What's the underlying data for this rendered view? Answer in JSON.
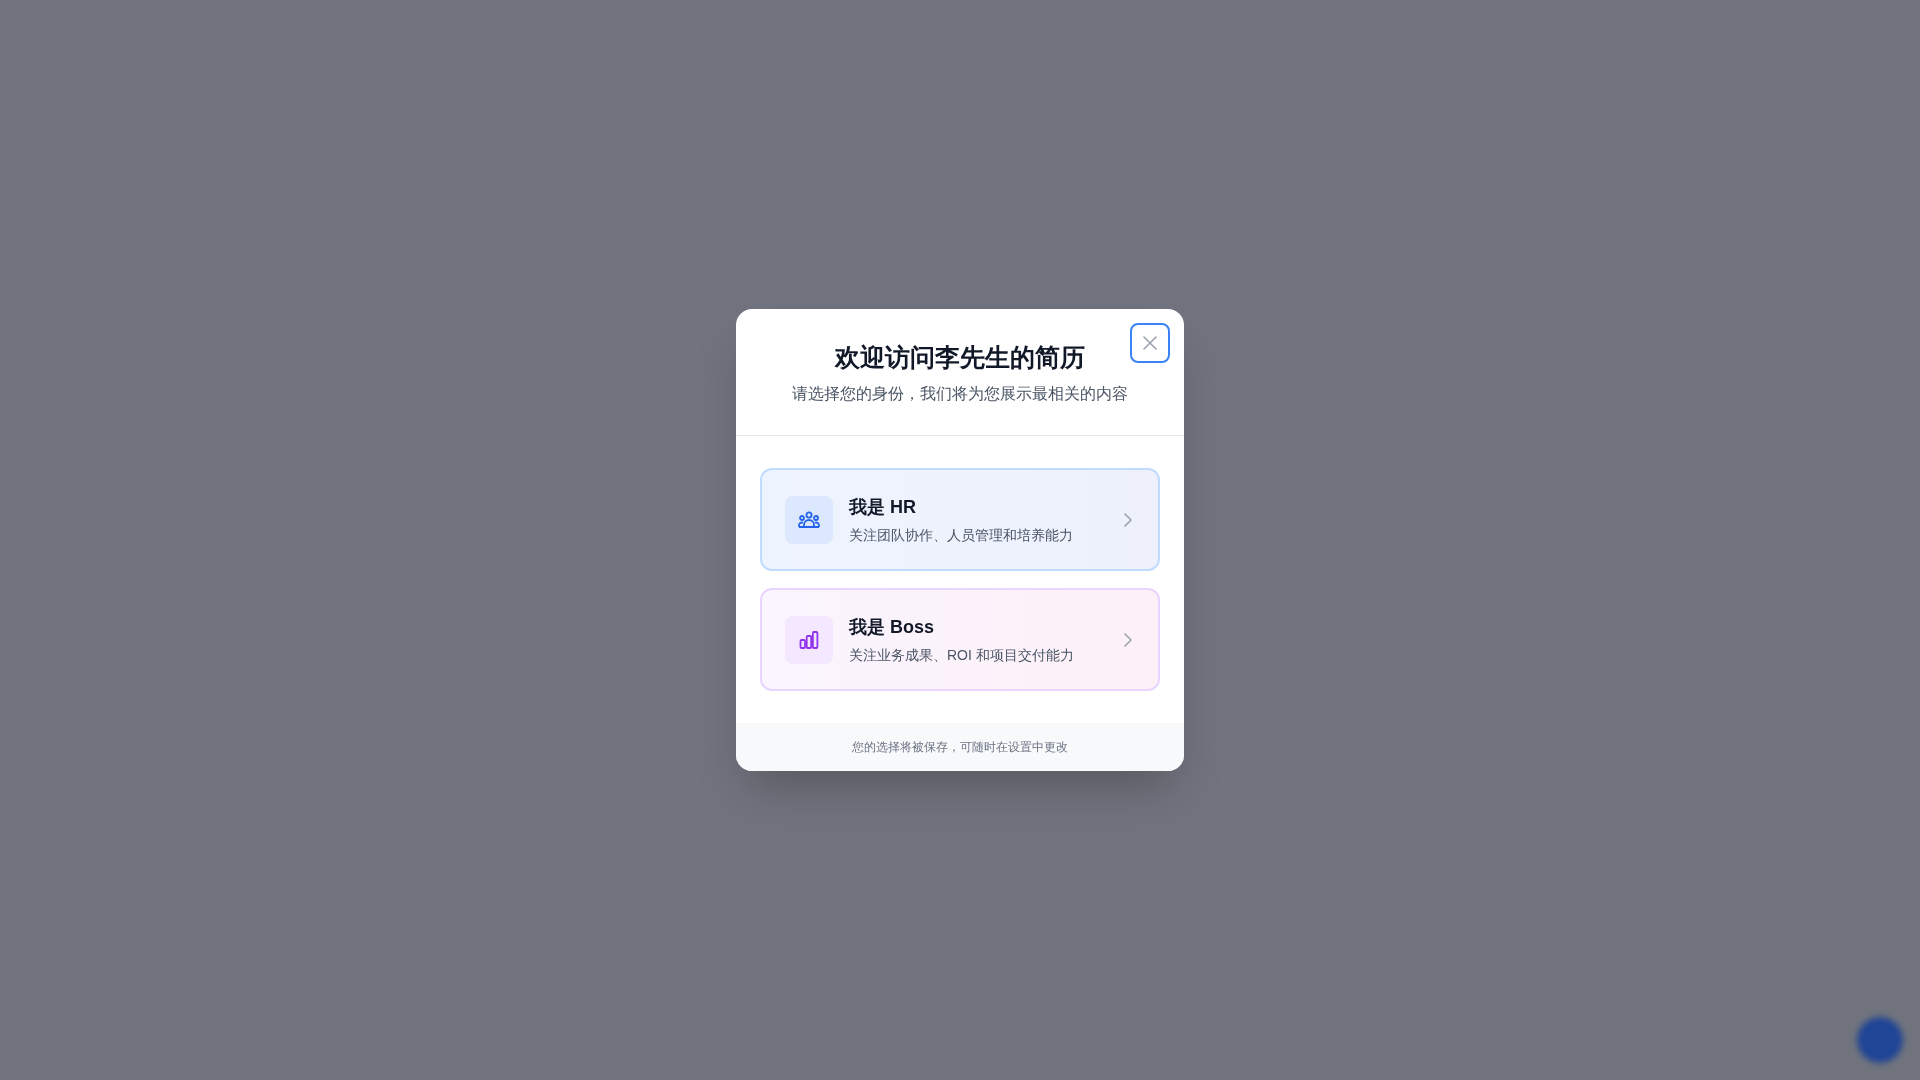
{
  "dialog": {
    "title": "欢迎访问李先生的简历",
    "subtitle": "请选择您的身份，我们将为您展示最相关的内容",
    "options": [
      {
        "kind": "hr",
        "title": "我是 HR",
        "description": "关注团队协作、人员管理和培养能力"
      },
      {
        "kind": "boss",
        "title": "我是 Boss",
        "description": "关注业务成果、ROI 和项目交付能力"
      }
    ],
    "footer": "您的选择将被保存，可随时在设置中更改"
  }
}
